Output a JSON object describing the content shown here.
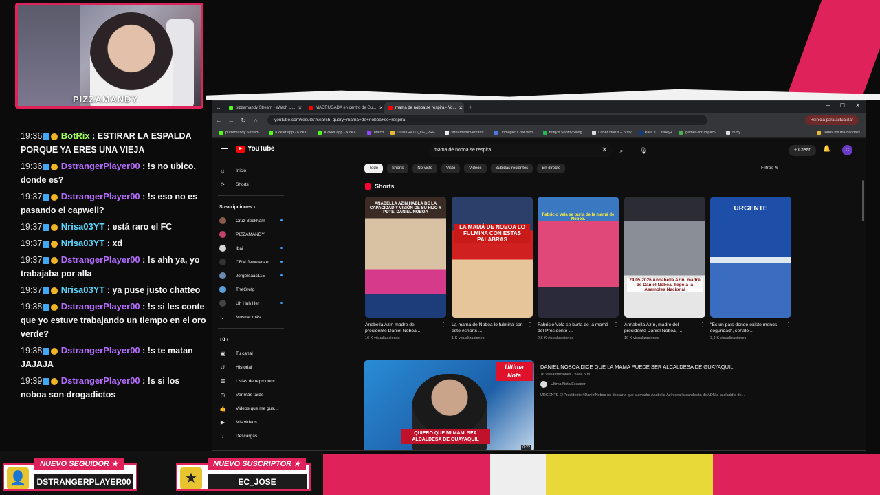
{
  "overlay": {
    "streamer_name": "PIZZAMANDY",
    "alerts": [
      {
        "tag": "NUEVO SEGUIDOR ★",
        "name": "DSTRANGERPLAYER00"
      },
      {
        "tag": "NUEVO SUSCRIPTOR ★",
        "name": "EC_JOSE"
      }
    ],
    "colors": {
      "accent": "#e0225a",
      "chat_user": "#b56cff",
      "bot_user": "#9cff5a"
    }
  },
  "chat": [
    {
      "time": "19:36",
      "user": "BotRix",
      "user_color": "#9cff5a",
      "text": "ESTIRAR LA ESPALDA PORQUE YA ERES UNA VIEJA"
    },
    {
      "time": "19:36",
      "user": "DstrangerPlayer00",
      "user_color": "#b56cff",
      "text": "!s no ubico, donde es?"
    },
    {
      "time": "19:37",
      "user": "DstrangerPlayer00",
      "user_color": "#b56cff",
      "text": "!s eso no es pasando el capwell?"
    },
    {
      "time": "19:37",
      "user": "Nrisa03YT",
      "user_color": "#5ad8ff",
      "text": "está raro el FC"
    },
    {
      "time": "19:37",
      "user": "Nrisa03YT",
      "user_color": "#5ad8ff",
      "text": "xd"
    },
    {
      "time": "19:37",
      "user": "DstrangerPlayer00",
      "user_color": "#b56cff",
      "text": "!s ahh ya, yo trabajaba por alla"
    },
    {
      "time": "19:37",
      "user": "Nrisa03YT",
      "user_color": "#5ad8ff",
      "text": "ya puse justo chatteo"
    },
    {
      "time": "19:38",
      "user": "DstrangerPlayer00",
      "user_color": "#b56cff",
      "text": "!s si les conte que yo estuve trabajando un tiempo en el oro verde?"
    },
    {
      "time": "19:38",
      "user": "DstrangerPlayer00",
      "user_color": "#b56cff",
      "text": "!s te matan JAJAJA"
    },
    {
      "time": "19:39",
      "user": "DstrangerPlayer00",
      "user_color": "#b56cff",
      "text": "!s si los noboa son drogadictos"
    }
  ],
  "browser": {
    "tabs": [
      {
        "label": "pizzamandy Stream - Watch Li...",
        "color": "#53fc18"
      },
      {
        "label": "MADRUGADA en centro de Gu...",
        "color": "#ff0000"
      },
      {
        "label": "mama de noboa se respira - Yo...",
        "color": "#ff0000",
        "active": true
      }
    ],
    "url": "youtube.com/results?search_query=mama+de+noboa+se+respira",
    "relaunch_label": "Reinicia para actualizar",
    "bookmarks": [
      "pizzamandy Stream...",
      "Kicklet.app - Kick C...",
      "Kicklet.app - Kick C...",
      "Twitch",
      "CONTRATO_DE_PRE...",
      "streamerunversitari...",
      "Uhmegle: Chat with...",
      "nutty's Spotify Widg...",
      "Order status – nutty",
      "Para ti | Disney+",
      "games-for-impact-...",
      "nutty",
      "Todos los marcadores"
    ]
  },
  "youtube": {
    "logo": "YouTube",
    "search_value": "mama de noboa se respira",
    "create_label": "Crear",
    "avatar_letter": "C",
    "sidebar": {
      "top": [
        {
          "icon": "⌂",
          "label": "Inicio"
        },
        {
          "icon": "⟳",
          "label": "Shorts"
        }
      ],
      "subs_header": "Suscripciones ›",
      "subs": [
        {
          "label": "Cruz Beckham",
          "color": "#8a5a4a",
          "live": true
        },
        {
          "label": "PIZZAMANDY",
          "color": "#c2446a",
          "live": false
        },
        {
          "label": "Ibai",
          "color": "#d4d4d4",
          "live": true
        },
        {
          "label": "CRM Jewelers e...",
          "color": "#333",
          "live": true
        },
        {
          "label": "JorgeIsaac115",
          "color": "#6a8ab0",
          "live": true
        },
        {
          "label": "TheGrefg",
          "color": "#5aa0d8",
          "live": false
        },
        {
          "label": "Uh Huh Her",
          "color": "#444",
          "live": true
        }
      ],
      "show_more": "Mostrar más",
      "you_header": "Tú ›",
      "you": [
        {
          "icon": "▣",
          "label": "Tu canal"
        },
        {
          "icon": "↺",
          "label": "Historial"
        },
        {
          "icon": "☰",
          "label": "Listas de reproducc..."
        },
        {
          "icon": "◷",
          "label": "Ver más tarde"
        },
        {
          "icon": "👍",
          "label": "Videos que me gus..."
        },
        {
          "icon": "▶",
          "label": "Mis videos"
        },
        {
          "icon": "↓",
          "label": "Descargas"
        }
      ]
    },
    "chips": [
      "Todo",
      "Shorts",
      "No visto",
      "Visto",
      "Videos",
      "Subidas recientes",
      "En directo"
    ],
    "filters_label": "Filtros",
    "shorts_header": "Shorts",
    "shorts": [
      {
        "caption": "ANABELLA AZIN HABLA DE LA CAPACIDAD Y VISIÓN DE SU HIJO Y PDTE. DANIEL NOBOA",
        "title": "Anabella Azin madre del presidente Daniel Noboa ...",
        "views": "16 K visualizaciones"
      },
      {
        "caption": "LA MAMÁ DE NOBOA LO FULMINA CON ESTAS PALABRAS",
        "title": "La mamá de Noboa lo fulmina con esto #shorts ...",
        "views": "1 K visualizaciones"
      },
      {
        "caption": "Fabricio Vela se burla de la mamá de Noboa.",
        "title": "Fabricio Vela se burla de la mamá del Presidente ...",
        "views": "2,6 K visualizaciones"
      },
      {
        "caption": "24.05.2026 Annabella Azín, madre de Daniel Noboa, llegó a la Asamblea Nacional",
        "title": "Annabella Azín, madre del presidente Daniel Noboa, ...",
        "views": "19 K visualizaciones"
      },
      {
        "caption": "URGENTE",
        "title": "\"Es un país donde existe menos seguridad\", señaló ...",
        "views": "3,4 K visualizaciones"
      }
    ],
    "video": {
      "title": "DANIEL NOBOA DICE QUE LA MAMA PUEDE SER ALCALDESA DE GUAYAQUIL",
      "meta": "76 visualizaciones · hace 5 m",
      "channel": "Última Nota Ecuador",
      "description": "URGENTE El Presidente #DanielNoboa no descarta que su madre Anabella Azín sea la candidata de ADN a la alcaldía de ...",
      "badge_top": "Última",
      "badge_bottom": "Nota",
      "thumb_caption": "QUIERO QUE MI MAMI SEA ALCALDESA DE GUAYAQUIL",
      "duration": "0:22"
    }
  }
}
